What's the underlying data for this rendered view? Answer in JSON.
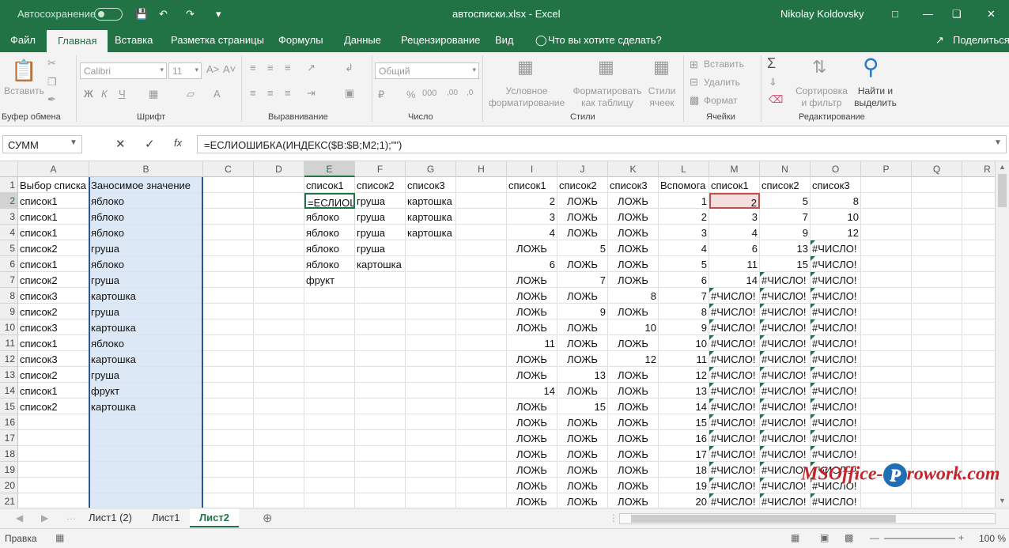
{
  "title": {
    "autosave": "Автосохранение",
    "file": "автосписки.xlsx  -  Excel",
    "user": "Nikolay Koldovsky"
  },
  "tabs": [
    "Файл",
    "Главная",
    "Вставка",
    "Разметка страницы",
    "Формулы",
    "Данные",
    "Рецензирование",
    "Вид",
    "Что вы хотите сделать?",
    "Поделиться"
  ],
  "ribbon": {
    "paste": "Вставить",
    "clipboard": "Буфер обмена",
    "font_name": "Calibri",
    "font_size": "11",
    "bold": "Ж",
    "italic": "К",
    "underline": "Ч",
    "font": "Шрифт",
    "align": "Выравнивание",
    "numfmt": "Общий",
    "number": "Число",
    "cond": "Условное форматирование",
    "astable": "Форматировать как таблицу",
    "styles_btn": "Стили ячеек",
    "styles": "Стили",
    "insert": "Вставить",
    "delete": "Удалить",
    "format": "Формат",
    "cells": "Ячейки",
    "sort": "Сортировка и фильтр",
    "find": "Найти и выделить",
    "editing": "Редактирование"
  },
  "namebox": "СУММ",
  "formula": "=ЕСЛИОШИБКА(ИНДЕКС($B:$B;M2;1);\"\")",
  "columns": [
    "A",
    "B",
    "C",
    "D",
    "E",
    "F",
    "G",
    "H",
    "I",
    "J",
    "K",
    "L",
    "M",
    "N",
    "O",
    "P",
    "Q",
    "R"
  ],
  "rows": [
    "1",
    "2",
    "3",
    "4",
    "5",
    "6",
    "7",
    "8",
    "9",
    "10",
    "11",
    "12",
    "13",
    "14",
    "15",
    "16",
    "17",
    "18",
    "19",
    "20",
    "21"
  ],
  "cells": {
    "A": [
      "Выбор списка",
      "список1",
      "список1",
      "список1",
      "список2",
      "список1",
      "список2",
      "список3",
      "список2",
      "список3",
      "список1",
      "список3",
      "список2",
      "список1",
      "список2",
      "",
      "",
      "",
      "",
      "",
      ""
    ],
    "B": [
      "Заносимое значение",
      "яблоко",
      "яблоко",
      "яблоко",
      "груша",
      "яблоко",
      "груша",
      "картошка",
      "груша",
      "картошка",
      "яблоко",
      "картошка",
      "груша",
      "фрукт",
      "картошка",
      "",
      "",
      "",
      "",
      "",
      ""
    ],
    "E": [
      "список1",
      "=ЕСЛИОШ",
      "яблоко",
      "яблоко",
      "яблоко",
      "яблоко",
      "фрукт",
      "",
      "",
      "",
      "",
      "",
      "",
      "",
      "",
      "",
      "",
      "",
      "",
      "",
      ""
    ],
    "F": [
      "список2",
      "груша",
      "груша",
      "груша",
      "груша",
      "картошка",
      "",
      "",
      "",
      "",
      "",
      "",
      "",
      "",
      "",
      "",
      "",
      "",
      "",
      "",
      ""
    ],
    "G": [
      "список3",
      "картошка",
      "картошка",
      "картошка",
      "",
      "",
      "",
      "",
      "",
      "",
      "",
      "",
      "",
      "",
      "",
      "",
      "",
      "",
      "",
      "",
      ""
    ],
    "I": [
      "список1",
      "2",
      "3",
      "4",
      "ЛОЖЬ",
      "6",
      "ЛОЖЬ",
      "ЛОЖЬ",
      "ЛОЖЬ",
      "ЛОЖЬ",
      "11",
      "ЛОЖЬ",
      "ЛОЖЬ",
      "14",
      "ЛОЖЬ",
      "ЛОЖЬ",
      "ЛОЖЬ",
      "ЛОЖЬ",
      "ЛОЖЬ",
      "ЛОЖЬ",
      "ЛОЖЬ"
    ],
    "J": [
      "список2",
      "ЛОЖЬ",
      "ЛОЖЬ",
      "ЛОЖЬ",
      "5",
      "ЛОЖЬ",
      "7",
      "ЛОЖЬ",
      "9",
      "ЛОЖЬ",
      "ЛОЖЬ",
      "ЛОЖЬ",
      "13",
      "ЛОЖЬ",
      "15",
      "ЛОЖЬ",
      "ЛОЖЬ",
      "ЛОЖЬ",
      "ЛОЖЬ",
      "ЛОЖЬ",
      "ЛОЖЬ"
    ],
    "K": [
      "список3",
      "ЛОЖЬ",
      "ЛОЖЬ",
      "ЛОЖЬ",
      "ЛОЖЬ",
      "ЛОЖЬ",
      "ЛОЖЬ",
      "8",
      "ЛОЖЬ",
      "10",
      "ЛОЖЬ",
      "12",
      "ЛОЖЬ",
      "ЛОЖЬ",
      "ЛОЖЬ",
      "ЛОЖЬ",
      "ЛОЖЬ",
      "ЛОЖЬ",
      "ЛОЖЬ",
      "ЛОЖЬ",
      "ЛОЖЬ"
    ],
    "L": [
      "Вспомога",
      "1",
      "2",
      "3",
      "4",
      "5",
      "6",
      "7",
      "8",
      "9",
      "10",
      "11",
      "12",
      "13",
      "14",
      "15",
      "16",
      "17",
      "18",
      "19",
      "20"
    ],
    "M": [
      "список1",
      "2",
      "3",
      "4",
      "6",
      "11",
      "14",
      "#ЧИСЛО!",
      "#ЧИСЛО!",
      "#ЧИСЛО!",
      "#ЧИСЛО!",
      "#ЧИСЛО!",
      "#ЧИСЛО!",
      "#ЧИСЛО!",
      "#ЧИСЛО!",
      "#ЧИСЛО!",
      "#ЧИСЛО!",
      "#ЧИСЛО!",
      "#ЧИСЛО!",
      "#ЧИСЛО!",
      "#ЧИСЛО!"
    ],
    "N": [
      "список2",
      "5",
      "7",
      "9",
      "13",
      "15",
      "#ЧИСЛО!",
      "#ЧИСЛО!",
      "#ЧИСЛО!",
      "#ЧИСЛО!",
      "#ЧИСЛО!",
      "#ЧИСЛО!",
      "#ЧИСЛО!",
      "#ЧИСЛО!",
      "#ЧИСЛО!",
      "#ЧИСЛО!",
      "#ЧИСЛО!",
      "#ЧИСЛО!",
      "#ЧИСЛО!",
      "#ЧИСЛО!",
      "#ЧИСЛО!"
    ],
    "O": [
      "список3",
      "8",
      "10",
      "12",
      "#ЧИСЛО!",
      "#ЧИСЛО!",
      "#ЧИСЛО!",
      "#ЧИСЛО!",
      "#ЧИСЛО!",
      "#ЧИСЛО!",
      "#ЧИСЛО!",
      "#ЧИСЛО!",
      "#ЧИСЛО!",
      "#ЧИСЛО!",
      "#ЧИСЛО!",
      "#ЧИСЛО!",
      "#ЧИСЛО!",
      "#ЧИСЛО!",
      "#ЧИСЛО!",
      "#ЧИСЛО!",
      "#ЧИСЛО!"
    ]
  },
  "sheets": [
    "Лист1 (2)",
    "Лист1",
    "Лист2"
  ],
  "status": {
    "mode": "Правка",
    "zoom": "100 %"
  },
  "watermark": "MSOffice-Prowork.com"
}
